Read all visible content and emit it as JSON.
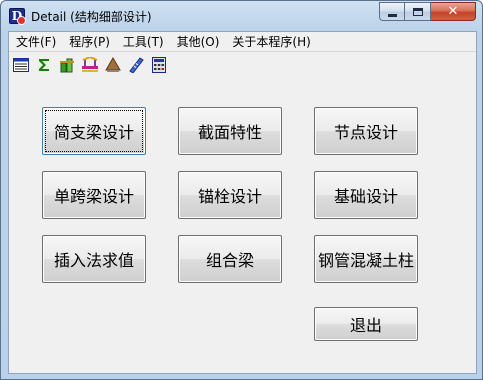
{
  "window": {
    "title": "Detail (结构细部设计)",
    "app_icon_letter": "D",
    "min_glyph": "",
    "max_glyph": "",
    "close_glyph": "✕"
  },
  "menu": [
    "文件(F)",
    "程序(P)",
    "工具(T)",
    "其他(O)",
    "关于本程序(H)"
  ],
  "toolbar_icons": [
    "table-icon",
    "sigma-icon",
    "column-icon",
    "bridge-icon",
    "foundation-icon",
    "ruler-icon",
    "calculator-icon"
  ],
  "buttons": {
    "simple_beam": "简支梁设计",
    "section_props": "截面特性",
    "node_design": "节点设计",
    "single_span": "单跨梁设计",
    "anchor_bolt": "锚栓设计",
    "foundation": "基础设计",
    "interpolation": "插入法求值",
    "composite_beam": "组合梁",
    "cfst_column": "钢管混凝土柱",
    "exit": "退出"
  },
  "colors": {
    "title_bg": "#bcd3ea",
    "client_bg": "#f0f0f0",
    "close_red": "#c5432a"
  }
}
